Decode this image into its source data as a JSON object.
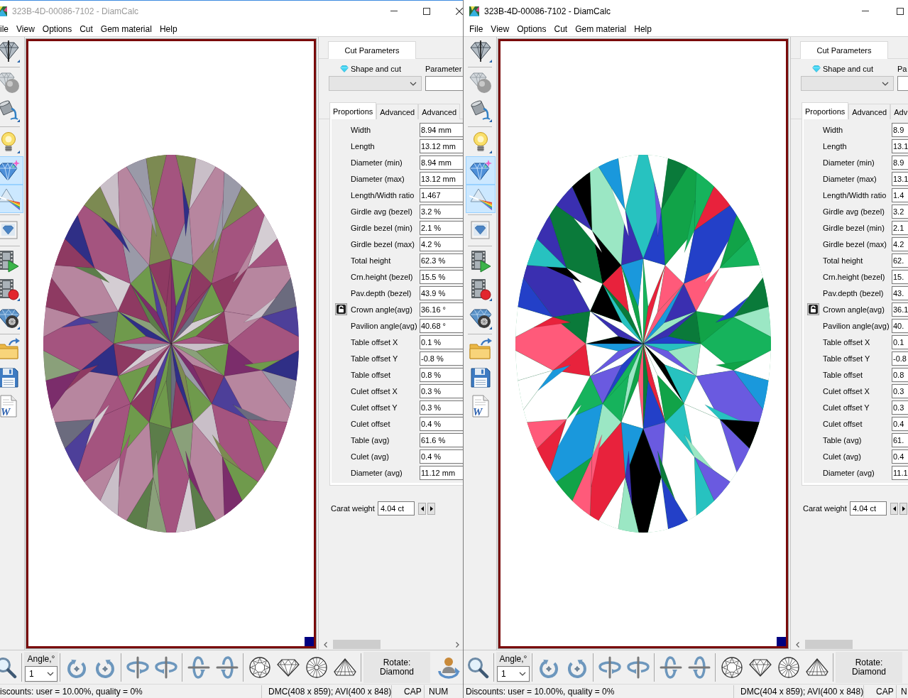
{
  "windows": [
    {
      "title": "323B-4D-00086-7102 - DiamCalc",
      "active": false,
      "menu": [
        "ile",
        "View",
        "Options",
        "Cut",
        "Gem material",
        "Help"
      ],
      "tools": [
        [
          {
            "kind": "view",
            "selected": false
          }
        ],
        [
          {
            "kind": "sphere",
            "selected": false
          },
          {
            "kind": "paint",
            "selected": false
          }
        ],
        [
          {
            "kind": "light",
            "selected": false
          },
          {
            "kind": "sparkle",
            "selected": true
          },
          {
            "kind": "prism",
            "selected": true
          }
        ],
        [
          {
            "kind": "picture",
            "selected": false
          }
        ],
        [
          {
            "kind": "play",
            "selected": false
          },
          {
            "kind": "record",
            "selected": false
          },
          {
            "kind": "wheel",
            "selected": false
          }
        ],
        [
          {
            "kind": "folder",
            "selected": false
          },
          {
            "kind": "save",
            "selected": false
          },
          {
            "kind": "document",
            "selected": false,
            "glyph": "W"
          }
        ]
      ],
      "view": {
        "kind": "muted"
      },
      "panel": {
        "tabs": [
          {
            "label": "Cut Parameters",
            "selected": true
          }
        ],
        "shape_label": "Shape and cut",
        "shape_select": {
          "disabled": true
        },
        "parameter_label": "Parameter",
        "subtabs": [
          {
            "label": "Proportions",
            "selected": true
          },
          {
            "label": "Advanced",
            "selected": false
          },
          {
            "label": "Advanced",
            "selected": false
          }
        ],
        "rows": [
          {
            "label": "Width",
            "value": "8.94 mm",
            "locked": false
          },
          {
            "label": "Length",
            "value": "13.12 mm",
            "locked": false
          },
          {
            "label": "Diameter (min)",
            "value": "8.94 mm",
            "locked": false
          },
          {
            "label": "Diameter (max)",
            "value": "13.12 mm",
            "locked": false
          },
          {
            "label": "Length/Width ratio",
            "value": "1.467",
            "locked": false
          },
          {
            "label": "Girdle avg (bezel)",
            "value": "3.2 %",
            "locked": false
          },
          {
            "label": "Girdle bezel (min)",
            "value": "2.1 %",
            "locked": false
          },
          {
            "label": "Girdle bezel (max)",
            "value": "4.2 %",
            "locked": false
          },
          {
            "label": "Total height",
            "value": "62.3 %",
            "locked": false
          },
          {
            "label": "Crn.height (bezel)",
            "value": "15.5 %",
            "locked": false
          },
          {
            "label": "Pav.depth (bezel)",
            "value": "43.9 %",
            "locked": false
          },
          {
            "label": "Crown angle(avg)",
            "value": "36.16 °",
            "locked": true
          },
          {
            "label": "Pavilion angle(avg)",
            "value": "40.68 °",
            "locked": false
          },
          {
            "label": "Table offset X",
            "value": "0.1 %",
            "locked": false
          },
          {
            "label": "Table offset Y",
            "value": "-0.8 %",
            "locked": false
          },
          {
            "label": "Table offset",
            "value": "0.8 %",
            "locked": false
          },
          {
            "label": "Culet offset X",
            "value": "0.3 %",
            "locked": false
          },
          {
            "label": "Culet offset Y",
            "value": "0.3 %",
            "locked": false
          },
          {
            "label": "Culet offset",
            "value": "0.4 %",
            "locked": false
          },
          {
            "label": "Table (avg)",
            "value": "61.6 %",
            "locked": false
          },
          {
            "label": "Culet (avg)",
            "value": "0.4 %",
            "locked": false
          },
          {
            "label": "Diameter (avg)",
            "value": "11.12 mm",
            "locked": false
          }
        ],
        "carat": {
          "label": "Carat weight",
          "value": "4.04 ct"
        }
      },
      "bottom_toolbar": {
        "angle_label": "Angle,°",
        "angle_value": "1",
        "rotate_button": "Rotate:\nDiamond",
        "extra_tools": [
          {
            "kind": "user-rotate"
          }
        ]
      },
      "status_bar": {
        "message": "iscounts: user = 10.00%, quality = 0%",
        "dimensions": "DMC(408 x 859); AVI(400 x 848)",
        "caps": "CAP",
        "num": "NUM"
      }
    },
    {
      "title": "323B-4D-00086-7102 - DiamCalc",
      "active": true,
      "menu": [
        "File",
        "View",
        "Options",
        "Cut",
        "Gem material",
        "Help"
      ],
      "tools": [
        [
          {
            "kind": "view",
            "selected": false
          }
        ],
        [
          {
            "kind": "sphere",
            "selected": false
          },
          {
            "kind": "paint",
            "selected": false
          }
        ],
        [
          {
            "kind": "light",
            "selected": false
          },
          {
            "kind": "sparkle",
            "selected": true
          },
          {
            "kind": "prism",
            "selected": true
          }
        ],
        [
          {
            "kind": "picture",
            "selected": false
          }
        ],
        [
          {
            "kind": "play",
            "selected": false
          },
          {
            "kind": "record",
            "selected": false
          },
          {
            "kind": "wheel",
            "selected": false
          }
        ],
        [
          {
            "kind": "folder",
            "selected": false
          },
          {
            "kind": "save",
            "selected": false
          },
          {
            "kind": "document",
            "selected": false,
            "glyph": "W"
          }
        ]
      ],
      "view": {
        "kind": "vivid"
      },
      "panel": {
        "tabs": [
          {
            "label": "Cut Parameters",
            "selected": true
          }
        ],
        "shape_label": "Shape and cut",
        "shape_select": {
          "disabled": true
        },
        "parameter_label": "Pa",
        "subtabs": [
          {
            "label": "Proportions",
            "selected": true
          },
          {
            "label": "Advanced",
            "selected": false
          },
          {
            "label": "Adv",
            "selected": false
          }
        ],
        "rows": [
          {
            "label": "Width",
            "value": "8.9",
            "locked": false
          },
          {
            "label": "Length",
            "value": "13.1",
            "locked": false
          },
          {
            "label": "Diameter (min)",
            "value": "8.9",
            "locked": false
          },
          {
            "label": "Diameter (max)",
            "value": "13.1",
            "locked": false
          },
          {
            "label": "Length/Width ratio",
            "value": "1.4",
            "locked": false
          },
          {
            "label": "Girdle avg (bezel)",
            "value": "3.2",
            "locked": false
          },
          {
            "label": "Girdle bezel (min)",
            "value": "2.1",
            "locked": false
          },
          {
            "label": "Girdle bezel (max)",
            "value": "4.2",
            "locked": false
          },
          {
            "label": "Total height",
            "value": "62.",
            "locked": false
          },
          {
            "label": "Crn.height (bezel)",
            "value": "15.",
            "locked": false
          },
          {
            "label": "Pav.depth (bezel)",
            "value": "43.",
            "locked": false
          },
          {
            "label": "Crown angle(avg)",
            "value": "36.1",
            "locked": true
          },
          {
            "label": "Pavilion angle(avg)",
            "value": "40.",
            "locked": false
          },
          {
            "label": "Table offset X",
            "value": "0.1",
            "locked": false
          },
          {
            "label": "Table offset Y",
            "value": "-0.8",
            "locked": false
          },
          {
            "label": "Table offset",
            "value": "0.8",
            "locked": false
          },
          {
            "label": "Culet offset X",
            "value": "0.3",
            "locked": false
          },
          {
            "label": "Culet offset Y",
            "value": "0.3",
            "locked": false
          },
          {
            "label": "Culet offset",
            "value": "0.4",
            "locked": false
          },
          {
            "label": "Table (avg)",
            "value": "61.",
            "locked": false
          },
          {
            "label": "Culet (avg)",
            "value": "0.4",
            "locked": false
          },
          {
            "label": "Diameter (avg)",
            "value": "11.1",
            "locked": false
          }
        ],
        "carat": {
          "label": "Carat weight",
          "value": "4.04 ct"
        }
      },
      "bottom_toolbar": {
        "angle_label": "Angle,°",
        "angle_value": "1",
        "rotate_button": "Rotate:\nDiamond"
      },
      "status_bar": {
        "message": "Discounts: user = 10.00%, quality = 0%",
        "dimensions": "DMC(404 x 859); AVI(400 x 848)",
        "caps": "CAP",
        "num": "N"
      }
    }
  ]
}
